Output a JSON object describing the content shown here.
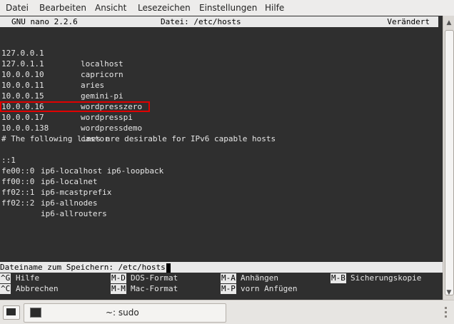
{
  "menubar": [
    "Datei",
    "Bearbeiten",
    "Ansicht",
    "Lesezeichen",
    "Einstellungen",
    "Hilfe"
  ],
  "nano": {
    "version": "GNU nano 2.2.6",
    "file": "Datei: /etc/hosts",
    "status": "Verändert"
  },
  "hosts": [
    {
      "ip": "127.0.0.1",
      "name": "localhost"
    },
    {
      "ip": "127.0.1.1",
      "name": "capricorn"
    },
    {
      "ip": "10.0.0.10",
      "name": "aries"
    },
    {
      "ip": "10.0.0.11",
      "name": "gemini-pi"
    },
    {
      "ip": "10.0.0.15",
      "name": "wordpresszero"
    },
    {
      "ip": "10.0.0.16",
      "name": "wordpresspi"
    },
    {
      "ip": "10.0.0.17",
      "name": "wordpressdemo"
    },
    {
      "ip": "10.0.0.138",
      "name": "castor"
    }
  ],
  "comment": "# The following lines are desirable for IPv6 capable hosts",
  "ipv6": [
    {
      "ip": "::1",
      "name": "ip6-localhost ip6-loopback"
    },
    {
      "ip": "fe00::0",
      "name": "ip6-localnet"
    },
    {
      "ip": "ff00::0",
      "name": "ip6-mcastprefix"
    },
    {
      "ip": "ff02::1",
      "name": "ip6-allnodes"
    },
    {
      "ip": "ff02::2",
      "name": "ip6-allrouters"
    }
  ],
  "prompt": "Dateiname zum Speichern: /etc/hosts",
  "shortcuts": [
    {
      "key": "^G",
      "label": "Hilfe"
    },
    {
      "key": "M-D",
      "label": "DOS-Format"
    },
    {
      "key": "M-A",
      "label": "Anhängen"
    },
    {
      "key": "M-B",
      "label": "Sicherungskopie"
    },
    {
      "key": "^C",
      "label": "Abbrechen"
    },
    {
      "key": "M-M",
      "label": "Mac-Format"
    },
    {
      "key": "M-P",
      "label": "vorn Anfügen"
    }
  ],
  "taskbar": {
    "task_label": "~: sudo"
  }
}
